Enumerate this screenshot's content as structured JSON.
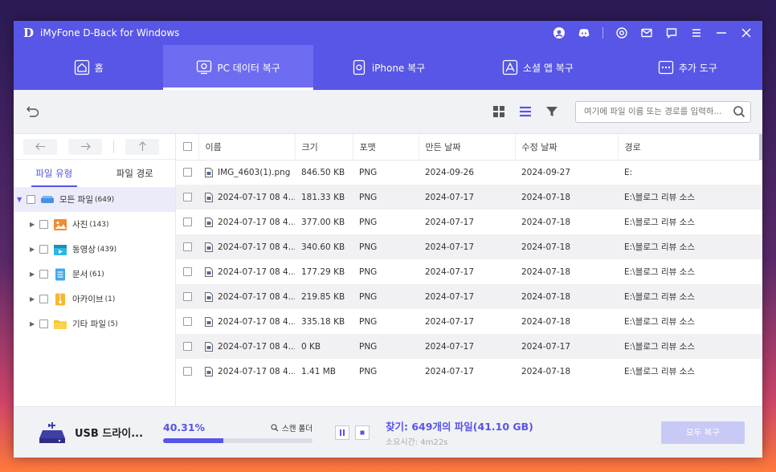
{
  "titlebar": {
    "logo": "D",
    "title": "iMyFone D-Back for Windows",
    "icons": [
      "account-icon",
      "discord-icon",
      "settings-icon",
      "mail-icon",
      "chat-icon",
      "menu-icon",
      "minimize-icon",
      "close-icon"
    ]
  },
  "nav": {
    "tabs": [
      {
        "label": "홈",
        "icon": "home-icon"
      },
      {
        "label": "PC 데이터 복구",
        "icon": "pc-recovery-icon"
      },
      {
        "label": "iPhone 복구",
        "icon": "iphone-icon"
      },
      {
        "label": "소셜 앱 복구",
        "icon": "social-app-icon"
      },
      {
        "label": "추가 도구",
        "icon": "more-tools-icon"
      }
    ],
    "active_index": 1
  },
  "toolbar": {
    "search_placeholder": "여기에 파일 이름 또는 경로를 입력하...",
    "icons": [
      "undo-icon",
      "grid-view-icon",
      "list-view-icon",
      "filter-icon",
      "search-icon"
    ]
  },
  "sidebar": {
    "tabs": {
      "type": "파일 유형",
      "path": "파일 경로"
    },
    "root": {
      "label": "모든 파일",
      "count": "(649)"
    },
    "items": [
      {
        "label": "사진",
        "count": "(143)",
        "icon": "photo-icon"
      },
      {
        "label": "동영상",
        "count": "(439)",
        "icon": "video-icon"
      },
      {
        "label": "문서",
        "count": "(61)",
        "icon": "document-icon"
      },
      {
        "label": "아카이브",
        "count": "(1)",
        "icon": "archive-icon"
      },
      {
        "label": "기타 파일",
        "count": "(5)",
        "icon": "folder-icon"
      }
    ]
  },
  "table": {
    "headers": {
      "name": "이름",
      "size": "크기",
      "format": "포맷",
      "created": "만든 날짜",
      "modified": "수정 날짜",
      "path": "경로"
    },
    "rows": [
      {
        "name": "IMG_4603(1).png",
        "size": "846.50 KB",
        "format": "PNG",
        "created": "2024-09-26",
        "modified": "2024-09-27",
        "path": "E:"
      },
      {
        "name": "2024-07-17 08 4...",
        "size": "181.33 KB",
        "format": "PNG",
        "created": "2024-07-17",
        "modified": "2024-07-18",
        "path": "E:\\블로그 리뷰 소스"
      },
      {
        "name": "2024-07-17 08 4...",
        "size": "377.00 KB",
        "format": "PNG",
        "created": "2024-07-17",
        "modified": "2024-07-18",
        "path": "E:\\블로그 리뷰 소스"
      },
      {
        "name": "2024-07-17 08 4...",
        "size": "340.60 KB",
        "format": "PNG",
        "created": "2024-07-17",
        "modified": "2024-07-18",
        "path": "E:\\블로그 리뷰 소스"
      },
      {
        "name": "2024-07-17 08 4...",
        "size": "177.29 KB",
        "format": "PNG",
        "created": "2024-07-17",
        "modified": "2024-07-18",
        "path": "E:\\블로그 리뷰 소스"
      },
      {
        "name": "2024-07-17 08 4...",
        "size": "219.85 KB",
        "format": "PNG",
        "created": "2024-07-17",
        "modified": "2024-07-18",
        "path": "E:\\블로그 리뷰 소스"
      },
      {
        "name": "2024-07-17 08 4...",
        "size": "335.18 KB",
        "format": "PNG",
        "created": "2024-07-17",
        "modified": "2024-07-18",
        "path": "E:\\블로그 리뷰 소스"
      },
      {
        "name": "2024-07-17 08 4...",
        "size": "0 KB",
        "format": "PNG",
        "created": "2024-07-17",
        "modified": "2024-07-17",
        "path": "E:\\블로그 리뷰 소스"
      },
      {
        "name": "2024-07-17 08 4...",
        "size": "1.41 MB",
        "format": "PNG",
        "created": "2024-07-17",
        "modified": "2024-07-18",
        "path": "E:\\블로그 리뷰 소스"
      }
    ]
  },
  "status": {
    "drive": "USB 드라이...",
    "percent": "40.31%",
    "progress_fraction": 0.4031,
    "scan_folder_label": "스캔 폴더",
    "found": "찾기: 649개의 파일(41.10 GB)",
    "elapsed": "소요시간: 4m22s",
    "recover_label": "모두 복구"
  },
  "colors": {
    "accent": "#5756e6",
    "recover_disabled": "#c9c9f6"
  }
}
